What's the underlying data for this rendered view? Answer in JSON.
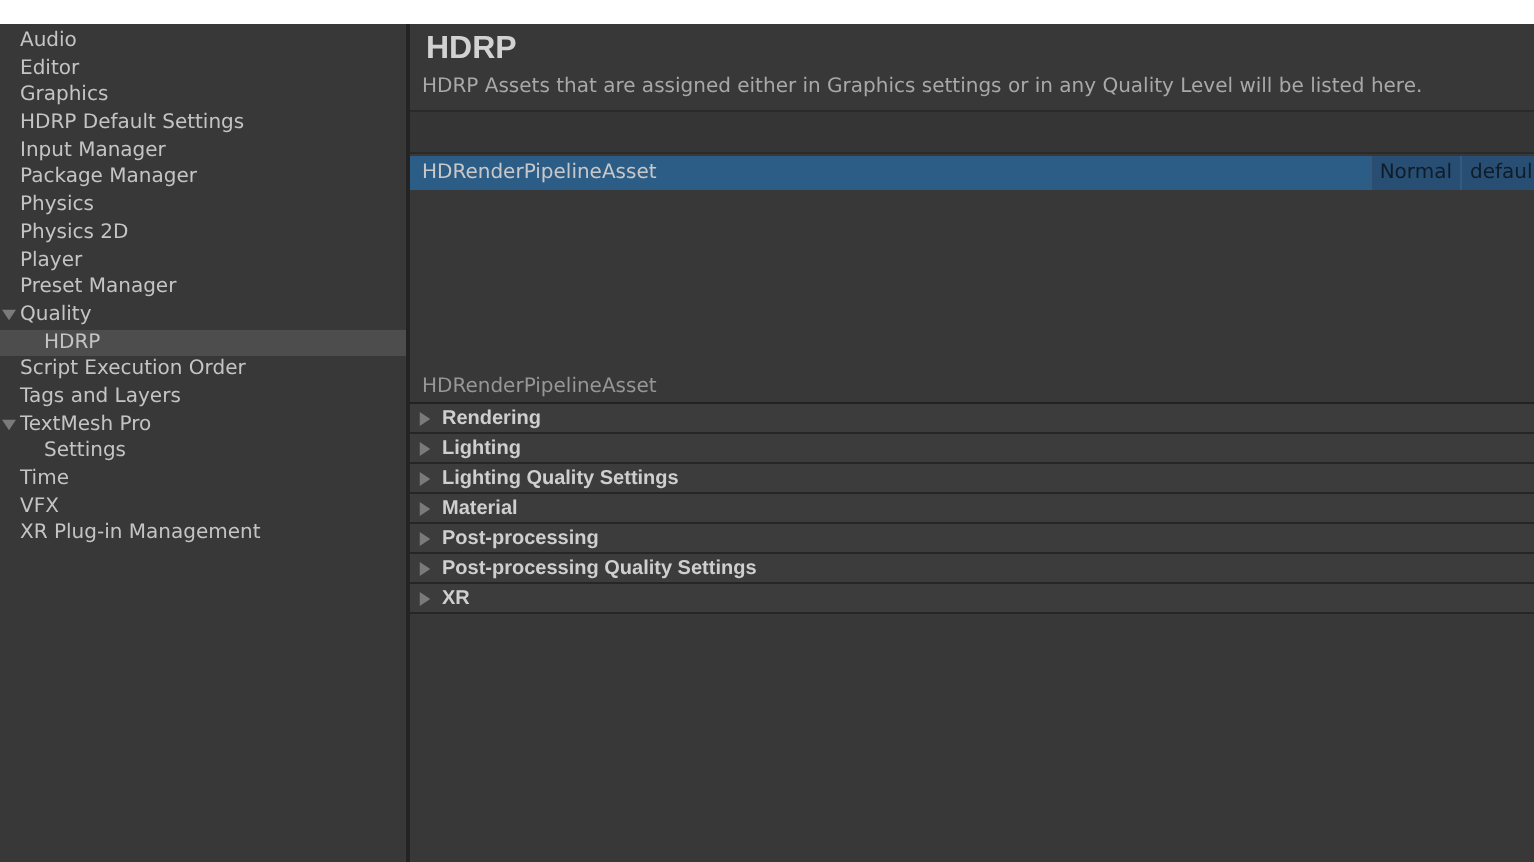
{
  "sidebar": {
    "items": [
      {
        "label": "Audio",
        "selected": false
      },
      {
        "label": "Editor",
        "selected": false
      },
      {
        "label": "Graphics",
        "selected": false
      },
      {
        "label": "HDRP Default Settings",
        "selected": false
      },
      {
        "label": "Input Manager",
        "selected": false
      },
      {
        "label": "Package Manager",
        "selected": false
      },
      {
        "label": "Physics",
        "selected": false
      },
      {
        "label": "Physics 2D",
        "selected": false
      },
      {
        "label": "Player",
        "selected": false
      },
      {
        "label": "Preset Manager",
        "selected": false
      },
      {
        "label": "Quality",
        "selected": false,
        "expanded": true,
        "children": [
          {
            "label": "HDRP",
            "selected": true
          }
        ]
      },
      {
        "label": "Script Execution Order",
        "selected": false
      },
      {
        "label": "Tags and Layers",
        "selected": false
      },
      {
        "label": "TextMesh Pro",
        "selected": false,
        "expanded": true,
        "children": [
          {
            "label": "Settings",
            "selected": false
          }
        ]
      },
      {
        "label": "Time",
        "selected": false
      },
      {
        "label": "VFX",
        "selected": false
      },
      {
        "label": "XR Plug-in Management",
        "selected": false
      }
    ]
  },
  "header": {
    "title": "HDRP",
    "description": "HDRP Assets that are assigned either in Graphics settings or in any Quality Level will be listed here."
  },
  "asset_list": {
    "rows": [
      {
        "name": "HDRenderPipelineAsset",
        "quality": "Normal",
        "column_3": "defaul",
        "selected": true
      }
    ]
  },
  "inspector": {
    "title": "HDRenderPipelineAsset",
    "sections": [
      {
        "label": "Rendering",
        "expanded": false
      },
      {
        "label": "Lighting",
        "expanded": false
      },
      {
        "label": "Lighting Quality Settings",
        "expanded": false
      },
      {
        "label": "Material",
        "expanded": false
      },
      {
        "label": "Post-processing",
        "expanded": false
      },
      {
        "label": "Post-processing Quality Settings",
        "expanded": false
      },
      {
        "label": "XR",
        "expanded": false
      }
    ]
  }
}
